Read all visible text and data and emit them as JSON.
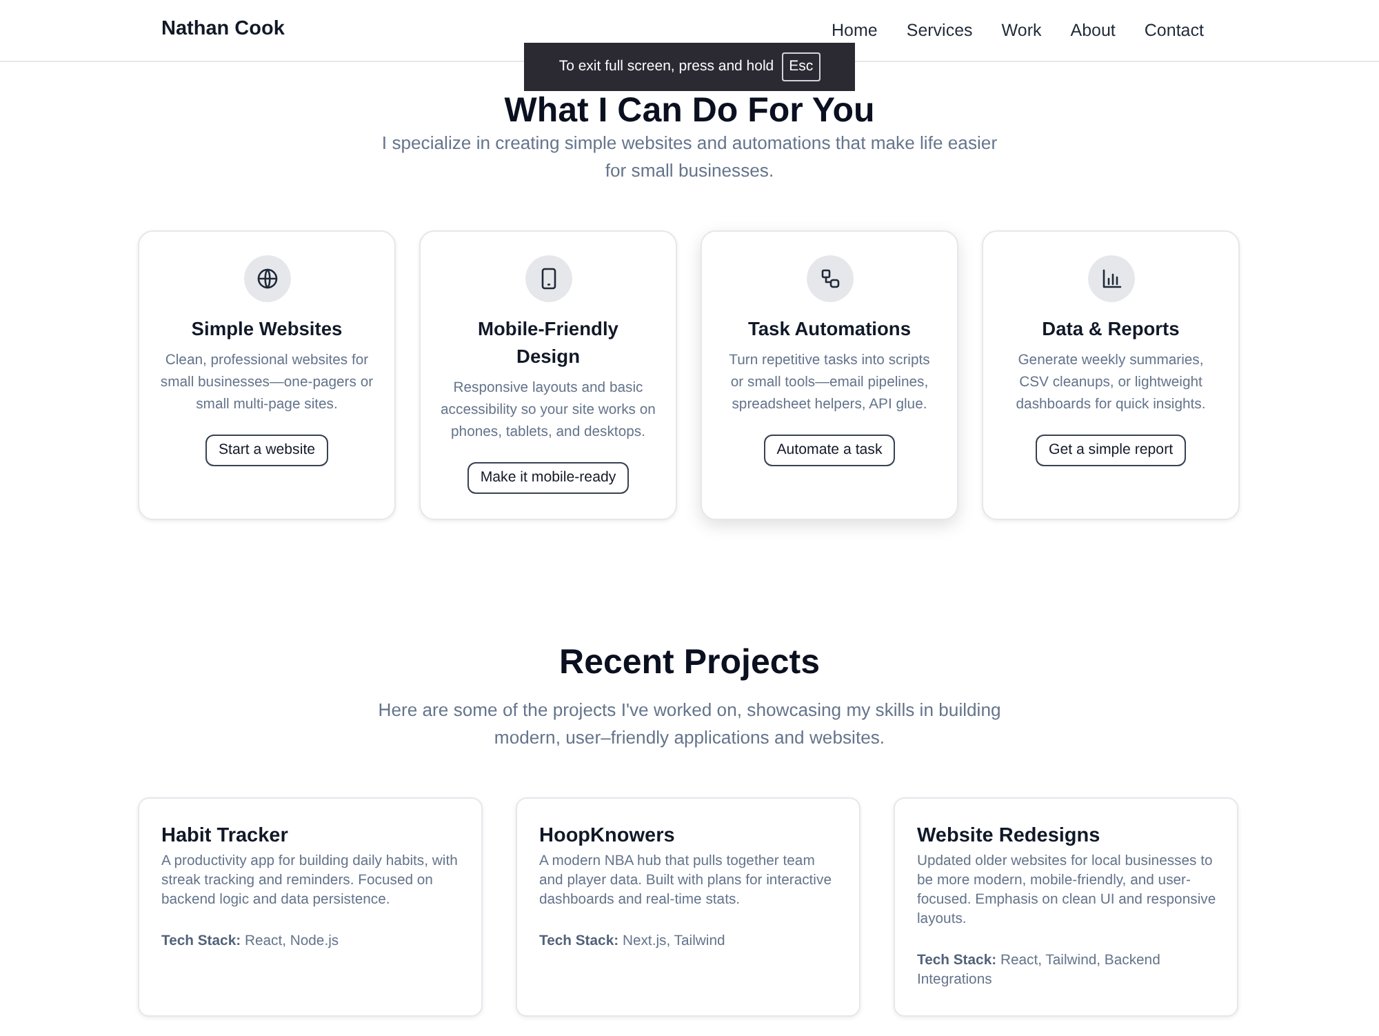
{
  "navbar": {
    "brand": "Nathan Cook",
    "links": [
      "Home",
      "Services",
      "Work",
      "About",
      "Contact"
    ]
  },
  "fullscreen_notice": {
    "message": "To exit full screen, press and hold",
    "key": "Esc"
  },
  "services": {
    "title": "What I Can Do For You",
    "subtitle": "I specialize in creating simple websites and automations that make life easier for small businesses.",
    "cards": [
      {
        "title": "Simple Websites",
        "description": "Clean, professional websites for small businesses—one-pagers or small multi-page sites.",
        "button": "Start a website",
        "hovered": false
      },
      {
        "title": "Mobile-Friendly Design",
        "description": "Responsive layouts and basic accessibility so your site works on phones, tablets, and desktops.",
        "button": "Make it mobile-ready",
        "hovered": false
      },
      {
        "title": "Task Automations",
        "description": "Turn repetitive tasks into scripts or small tools—email pipelines, spreadsheet helpers, API glue.",
        "button": "Automate a task",
        "hovered": true
      },
      {
        "title": "Data & Reports",
        "description": "Generate weekly summaries, CSV cleanups, or lightweight dashboards for quick insights.",
        "button": "Get a simple report",
        "hovered": false
      }
    ]
  },
  "projects": {
    "title": "Recent Projects",
    "subtitle": "Here are some of the projects I've worked on, showcasing my skills in building modern, user–friendly applications and websites.",
    "cards": [
      {
        "title": "Habit Tracker",
        "description": "A productivity app for building daily habits, with streak tracking and reminders. Focused on backend logic and data persistence.",
        "tech_stack": "**Tech Stack:** React, Node.js"
      },
      {
        "title": "HoopKnowers",
        "description": "A modern NBA hub that pulls together team and player data. Built with plans for interactive dashboards and real-time stats.",
        "tech_stack": "**Tech Stack:** Next.js, Tailwind"
      },
      {
        "title": "Website Redesigns",
        "description": "Updated older websites for local businesses to be more modern, mobile-friendly, and user-focused. Emphasis on clean UI and responsive layouts.",
        "tech_stack": "**Tech Stack:** React, Tailwind, Backend Integrations"
      }
    ]
  }
}
